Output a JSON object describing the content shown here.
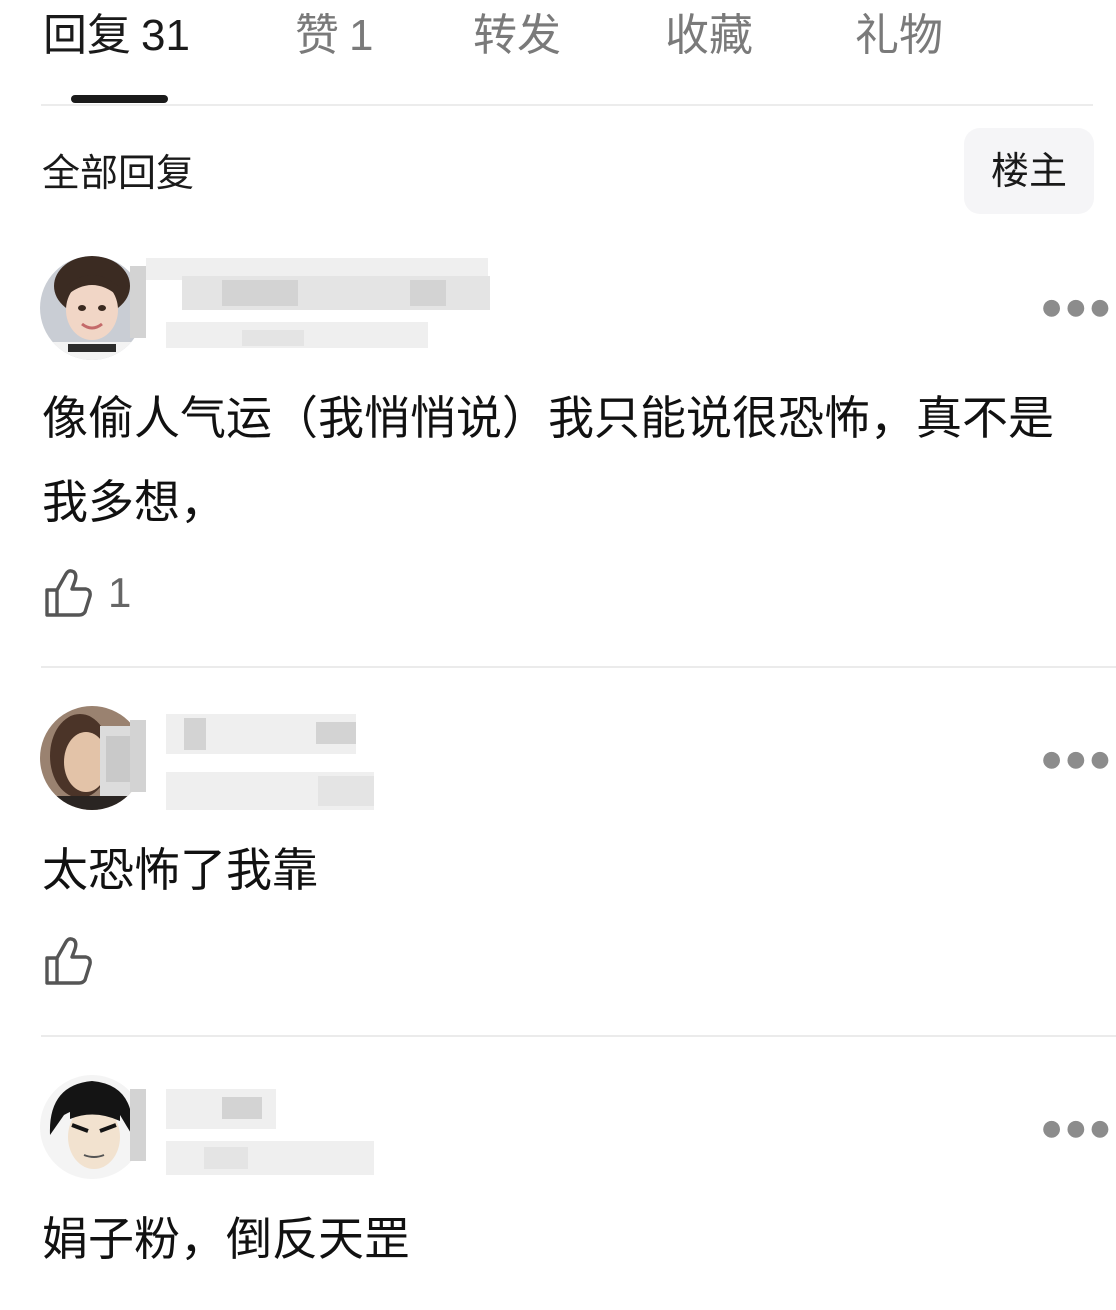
{
  "tabs": [
    {
      "label": "回复",
      "count": "31",
      "active": true
    },
    {
      "label": "赞",
      "count": "1"
    },
    {
      "label": "转发",
      "count": ""
    },
    {
      "label": "收藏",
      "count": ""
    },
    {
      "label": "礼物",
      "count": ""
    }
  ],
  "subheader": {
    "title": "全部回复",
    "owner_filter": "楼主"
  },
  "comments": [
    {
      "text": "像偷人气运（我悄悄说）我只能说很恐怖，真不是我多想，",
      "likes": "1",
      "more_icon": "ellipsis-icon",
      "like_icon": "thumbs-up-icon"
    },
    {
      "text": "太恐怖了我靠",
      "likes": "",
      "more_icon": "ellipsis-icon",
      "like_icon": "thumbs-up-icon"
    },
    {
      "text": "娟子粉，倒反天罡",
      "likes": "",
      "more_icon": "ellipsis-icon",
      "like_icon": "thumbs-up-icon"
    }
  ],
  "colors": {
    "text_primary": "#111111",
    "tab_inactive": "#7a7a7a",
    "divider": "#ebebeb",
    "owner_button_bg": "#f5f5f7"
  }
}
